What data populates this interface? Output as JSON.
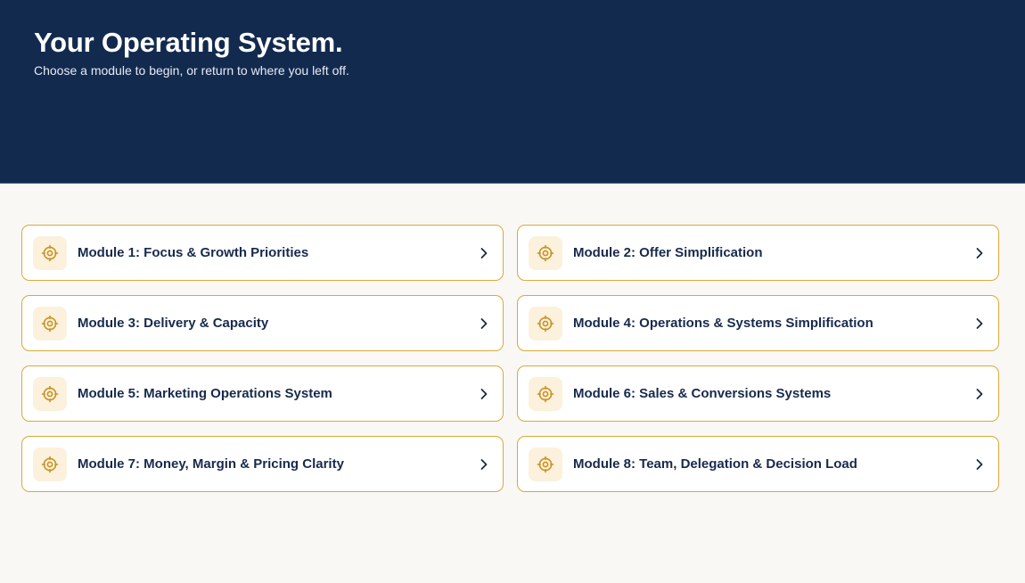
{
  "header": {
    "title": "Your Operating System.",
    "subtitle": "Choose a module to begin, or return to where you left off."
  },
  "colors": {
    "header_bg": "#132a4f",
    "page_bg": "#f9f8f5",
    "card_border": "#d9a93c",
    "icon_bg": "#fbf1dc",
    "icon_color": "#c99222",
    "text": "#172a4d"
  },
  "modules": [
    {
      "label": "Module 1: Focus & Growth Priorities",
      "icon": "target-icon",
      "action_icon": "chevron-right-icon"
    },
    {
      "label": "Module 2: Offer Simplification",
      "icon": "target-icon",
      "action_icon": "chevron-right-icon"
    },
    {
      "label": "Module 3: Delivery & Capacity",
      "icon": "target-icon",
      "action_icon": "chevron-right-icon"
    },
    {
      "label": "Module 4: Operations & Systems Simplification",
      "icon": "target-icon",
      "action_icon": "chevron-right-icon"
    },
    {
      "label": "Module 5: Marketing Operations System",
      "icon": "target-icon",
      "action_icon": "chevron-right-icon"
    },
    {
      "label": "Module 6: Sales & Conversions Systems",
      "icon": "target-icon",
      "action_icon": "chevron-right-icon"
    },
    {
      "label": "Module 7: Money, Margin & Pricing Clarity",
      "icon": "target-icon",
      "action_icon": "chevron-right-icon"
    },
    {
      "label": "Module 8: Team, Delegation & Decision Load",
      "icon": "target-icon",
      "action_icon": "chevron-right-icon"
    }
  ]
}
